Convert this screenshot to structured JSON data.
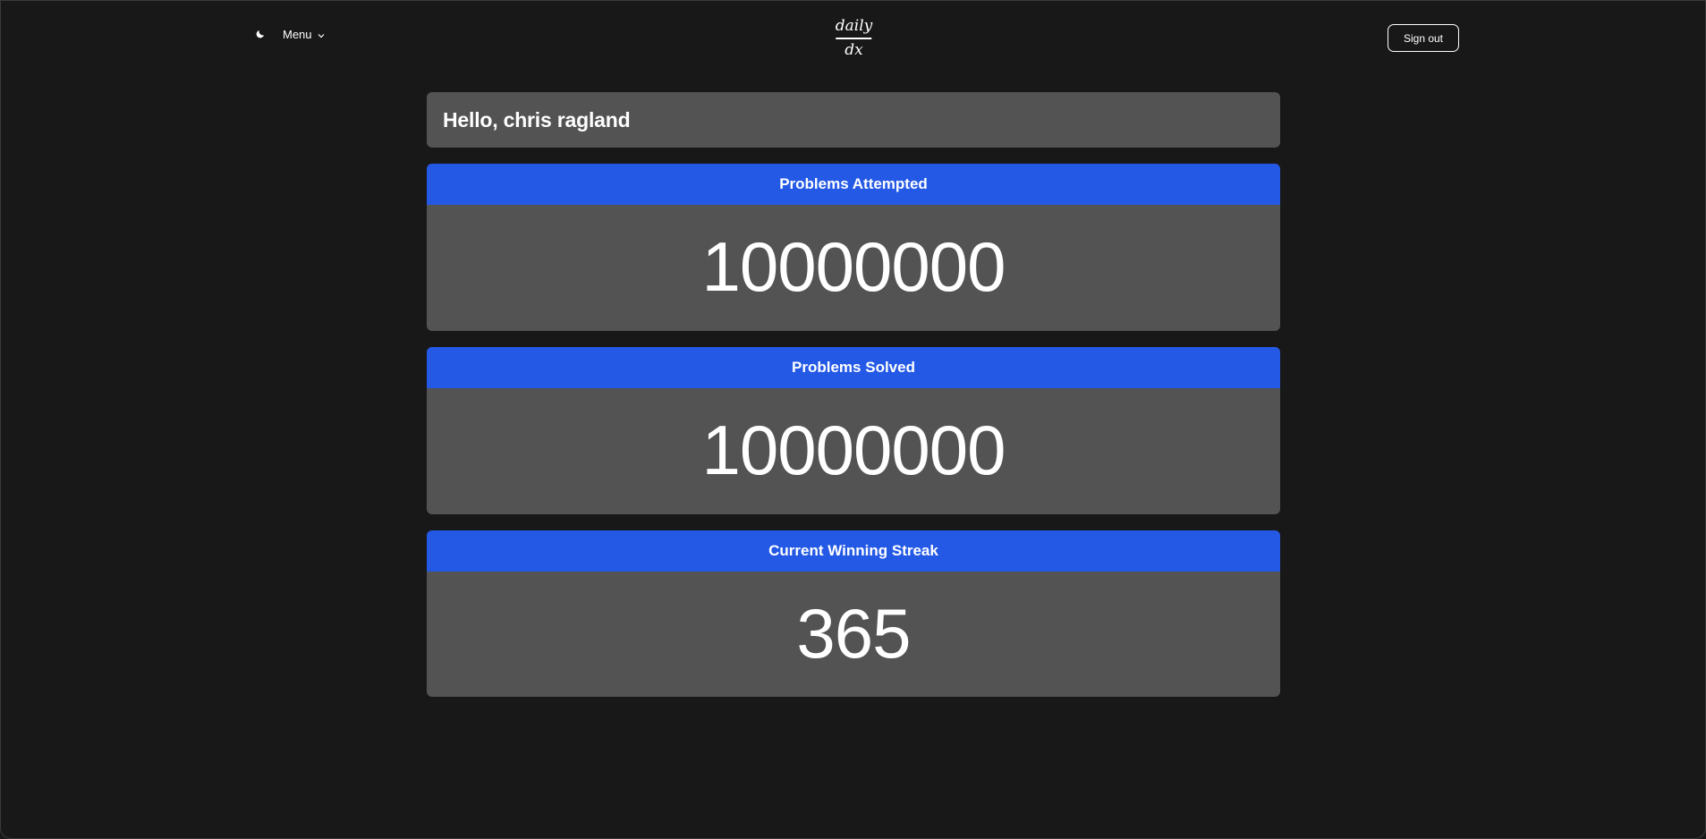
{
  "header": {
    "theme_icon": "moon-icon",
    "menu_label": "Menu",
    "logo": {
      "numerator": "daily",
      "denominator": "dx"
    },
    "signout_label": "Sign out"
  },
  "greeting": "Hello, chris ragland",
  "stats": [
    {
      "title": "Problems Attempted",
      "value": "10000000"
    },
    {
      "title": "Problems Solved",
      "value": "10000000"
    },
    {
      "title": "Current Winning Streak",
      "value": "365"
    }
  ],
  "colors": {
    "background": "#181818",
    "card": "#535353",
    "accent": "#2459e6",
    "text": "#ffffff"
  }
}
